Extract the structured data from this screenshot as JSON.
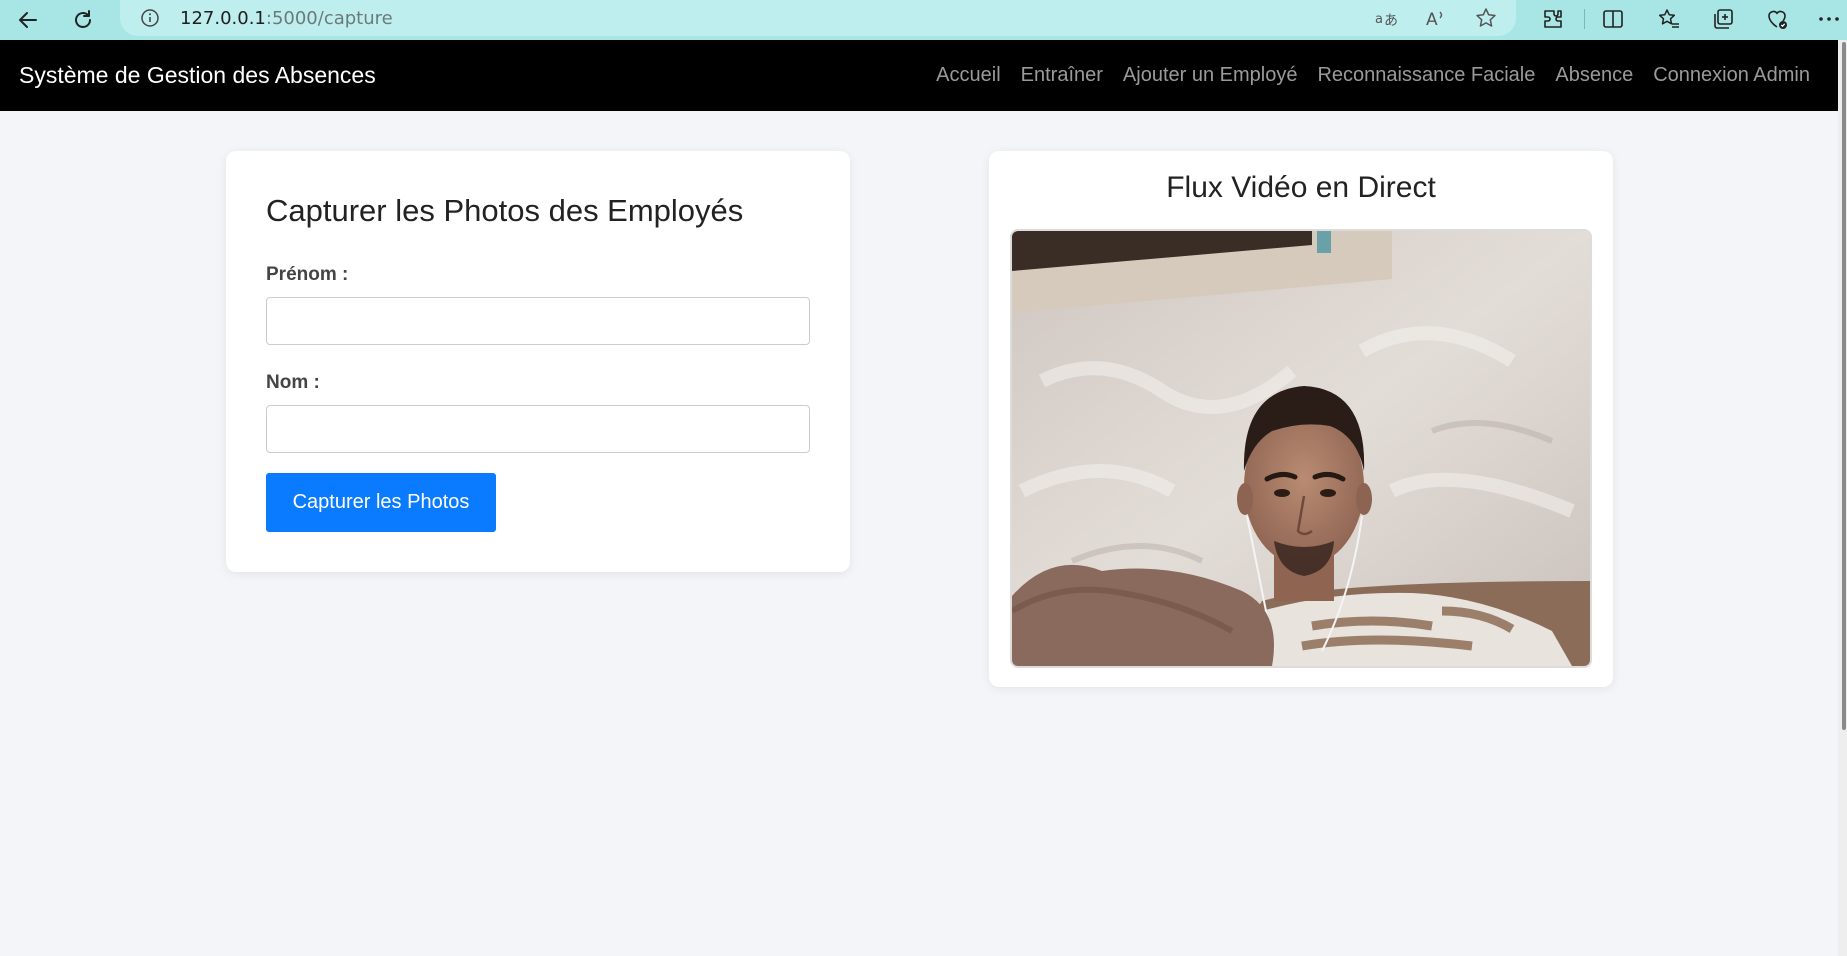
{
  "browser": {
    "url_host": "127.0.0.1",
    "url_path": ":5000/capture"
  },
  "navbar": {
    "brand": "Système de Gestion des Absences",
    "links": [
      {
        "label": "Accueil"
      },
      {
        "label": "Entraîner"
      },
      {
        "label": "Ajouter un Employé"
      },
      {
        "label": "Reconnaissance Faciale"
      },
      {
        "label": "Absence"
      },
      {
        "label": "Connexion Admin"
      }
    ]
  },
  "form": {
    "title": "Capturer les Photos des Employés",
    "first_name_label": "Prénom :",
    "first_name_value": "",
    "last_name_label": "Nom :",
    "last_name_value": "",
    "submit_label": "Capturer les Photos"
  },
  "video": {
    "title": "Flux Vidéo en Direct"
  },
  "colors": {
    "browser_bar": "#a8e6e6",
    "navbar": "#000000",
    "accent_button": "#0a7bff",
    "page_bg": "#f4f5f8"
  }
}
